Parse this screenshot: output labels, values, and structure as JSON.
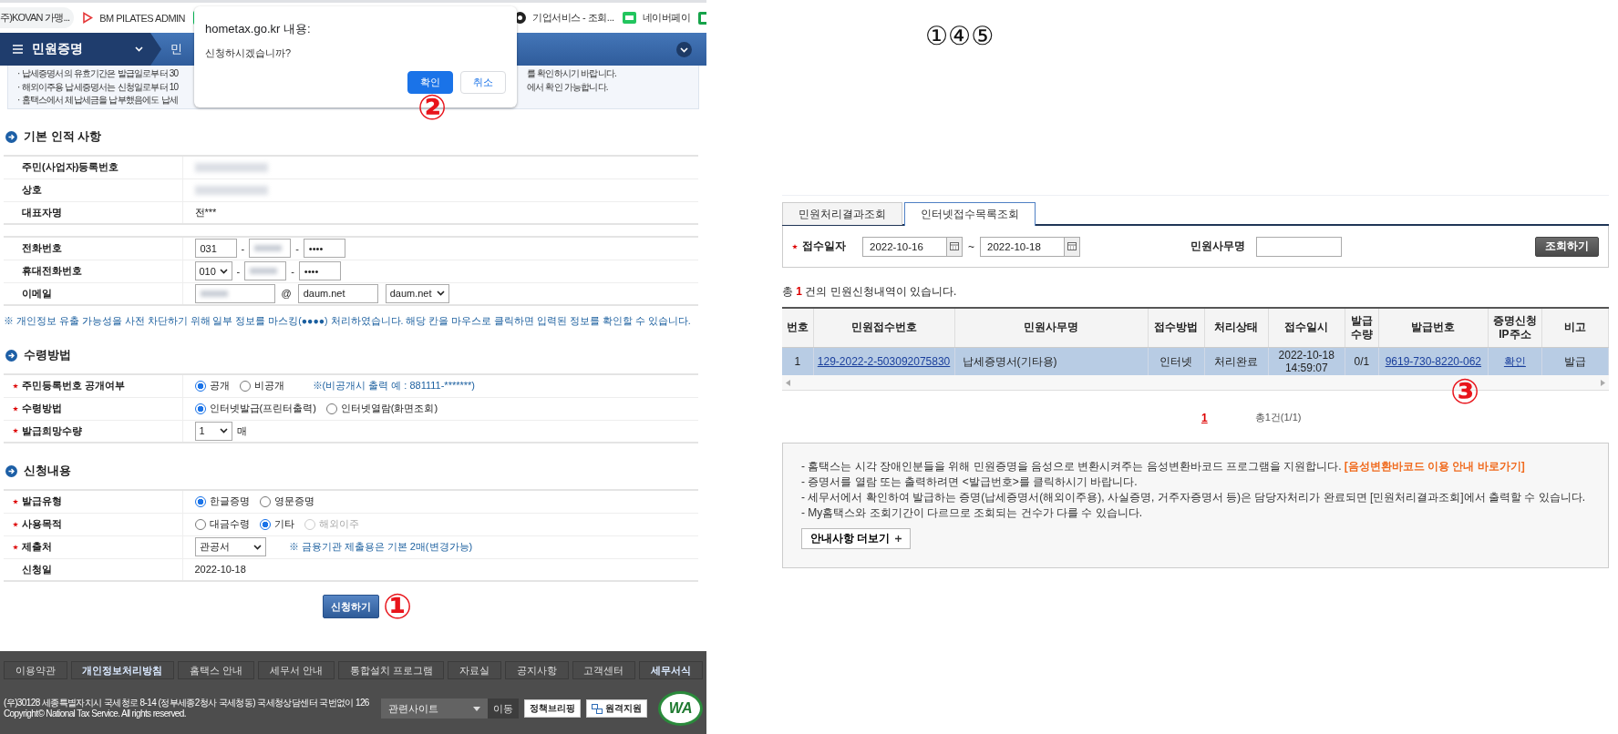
{
  "bookmarks_bar": {
    "items": [
      {
        "kind": "plain",
        "label": "주)KOVAN 가맹..."
      },
      {
        "kind": "triangle",
        "label": "BM PILATES ADMIN"
      },
      {
        "kind": "n-logo"
      },
      {
        "kind": "dark-circle",
        "label": "기업서비스 - 조회..."
      },
      {
        "kind": "pay",
        "label": "네이버페이"
      },
      {
        "kind": "sheet"
      }
    ]
  },
  "nav": {
    "title": "민원증명",
    "breadcrumb": "민"
  },
  "notice": {
    "lines": [
      {
        "left": "· 납세증명서의 유효기간은 발급일로부터 30",
        "right": "를 확인하시기 바랍니다."
      },
      {
        "left": "· 해외이주용 납세증명서는 신청일로부터 10",
        "right": "에서 확인 가능합니다."
      },
      {
        "left": "· 홈택스에서 체납세금을 납부했음에도 납세"
      }
    ]
  },
  "personal_info": {
    "title": "기본 인적 사항",
    "rows": [
      {
        "label": "주민(사업자)등록번호",
        "required": false,
        "kind": "masked"
      },
      {
        "label": "상호",
        "required": false,
        "kind": "masked"
      },
      {
        "label": "대표자명",
        "required": false,
        "kind": "text",
        "value": "전***"
      }
    ],
    "contact_rows": [
      {
        "label": "전화번호",
        "required": false,
        "kind": "fields",
        "fields": [
          {
            "kind": "input",
            "value": "031"
          },
          {
            "kind": "sep",
            "value": "-"
          },
          {
            "kind": "masked"
          },
          {
            "kind": "sep",
            "value": "-"
          },
          {
            "kind": "input",
            "value": "••••"
          }
        ]
      },
      {
        "label": "휴대전화번호",
        "required": false,
        "kind": "fields",
        "fields": [
          {
            "kind": "select",
            "value": "010"
          },
          {
            "kind": "sep",
            "value": "-"
          },
          {
            "kind": "masked"
          },
          {
            "kind": "sep",
            "value": "-"
          },
          {
            "kind": "input",
            "value": "••••"
          }
        ]
      },
      {
        "label": "이메일",
        "required": false,
        "kind": "fields",
        "fields": [
          {
            "kind": "masked"
          },
          {
            "kind": "sep",
            "value": "@"
          },
          {
            "kind": "input",
            "value": "daum.net"
          },
          {
            "kind": "select",
            "value": "daum.net"
          }
        ]
      }
    ],
    "note": "※ 개인정보 유출 가능성을 사전 차단하기 위해 일부 정보를 마스킹(●●●●) 처리하였습니다. 해당 칸을 마우스로 클릭하면 입력된 정보를 확인할 수 있습니다."
  },
  "receipt": {
    "title": "수령방법",
    "rows": [
      {
        "label": "주민등록번호 공개여부",
        "required": true,
        "kind": "radios",
        "options": [
          {
            "label": "공개",
            "selected": true,
            "disabled": false
          },
          {
            "label": "비공개",
            "selected": false,
            "disabled": false
          }
        ],
        "hint": "※(비공개시 출력 예 : 881111-*******)"
      },
      {
        "label": "수령방법",
        "required": true,
        "kind": "radios",
        "options": [
          {
            "label": "인터넷발급(프린터출력)",
            "selected": true,
            "disabled": false
          },
          {
            "label": "인터넷열람(화면조회)",
            "selected": false,
            "disabled": false
          }
        ]
      },
      {
        "label": "발급희망수량",
        "required": true,
        "kind": "select",
        "value": "1",
        "unit": "매"
      }
    ]
  },
  "application": {
    "title": "신청내용",
    "rows": [
      {
        "label": "발급유형",
        "required": true,
        "kind": "radios",
        "options": [
          {
            "label": "한글증명",
            "selected": true,
            "disabled": false
          },
          {
            "label": "영문증명",
            "selected": false,
            "disabled": false
          }
        ]
      },
      {
        "label": "사용목적",
        "required": true,
        "kind": "radios",
        "options": [
          {
            "label": "대금수령",
            "selected": false,
            "disabled": false
          },
          {
            "label": "기타",
            "selected": true,
            "disabled": false
          },
          {
            "label": "해외이주",
            "selected": false,
            "disabled": true
          }
        ]
      },
      {
        "label": "제출처",
        "required": true,
        "kind": "select",
        "value": "관공서",
        "hint": "※ 금융기관 제출용은 기본 2매(변경가능)"
      },
      {
        "label": "신청일",
        "required": false,
        "kind": "text",
        "value": "2022-10-18"
      }
    ]
  },
  "submit_button": "신청하기",
  "footer": {
    "links": [
      {
        "label": "이용약관",
        "emphasized": false
      },
      {
        "label": "개인정보처리방침",
        "emphasized": true
      },
      {
        "label": "홈택스 안내",
        "emphasized": false
      },
      {
        "label": "세무서 안내",
        "emphasized": false
      },
      {
        "label": "통합설치 프로그램",
        "emphasized": false
      },
      {
        "label": "자료실",
        "emphasized": false
      },
      {
        "label": "공지사항",
        "emphasized": false
      },
      {
        "label": "고객센터",
        "emphasized": false
      },
      {
        "label": "세무서식",
        "emphasized": true
      }
    ],
    "address": "(우)30128 세종특별자치시 국세청로 8-14 (정부세종2청사 국세청동) 국세청상담센터 국번없이 126",
    "copyright": "Copyright© National Tax Service. All rights reserved.",
    "related_sites": "관련사이트",
    "go_button": "이동",
    "briefing_button": "정책브리핑",
    "remote_button": "원격지원",
    "badge": "WA"
  },
  "dialog": {
    "title": "hometax.go.kr 내용:",
    "message": "신청하시겠습니까?",
    "buttons": [
      {
        "label": "확인",
        "primary": true
      },
      {
        "label": "취소",
        "primary": false
      }
    ]
  },
  "step_marks": [
    {
      "text": "②"
    },
    {
      "text": "①"
    },
    {
      "text": "③"
    }
  ],
  "top_annotation": "①④⑤",
  "results": {
    "tabs": [
      {
        "label": "민원처리결과조회",
        "selected": false
      },
      {
        "label": "인터넷접수목록조회",
        "selected": true
      }
    ],
    "filter": {
      "date_label": "접수일자",
      "from": "2022-10-16",
      "separator": "~",
      "to": "2022-10-18",
      "name_label": "민원사무명",
      "button": "조회하기"
    },
    "summary": "총 **1** 건의 민원신청내역이 있습니다.",
    "columns": [
      {
        "label": "번호",
        "kind": "text"
      },
      {
        "label": "민원접수번호",
        "kind": "link"
      },
      {
        "label": "민원사무명",
        "kind": "left"
      },
      {
        "label": "접수방법",
        "kind": "text"
      },
      {
        "label": "처리상태",
        "kind": "text"
      },
      {
        "label": "접수일시",
        "kind": "text"
      },
      {
        "label": "발급 수량",
        "kind": "text"
      },
      {
        "label": "발급번호",
        "kind": "link"
      },
      {
        "label": "증명신청 IP주소",
        "kind": "link"
      },
      {
        "label": "비고",
        "kind": "text"
      }
    ],
    "rows": [
      {
        "selected": true,
        "cells": [
          "1",
          "129-2022-2-503092075830",
          "납세증명서(기타용)",
          "인터넷",
          "처리완료",
          "2022-10-18 14:59:07",
          "0/1",
          "9619-730-8220-062",
          "확인",
          "발급"
        ]
      }
    ],
    "pages": [
      {
        "label": "1",
        "selected": true
      }
    ],
    "total": "총1건(1/1)"
  },
  "notes": {
    "lines": [
      {
        "text": "- 홈택스는 시각 장애인분들을 위해 민원증명을 음성으로 변환시켜주는 음성변환바코드 프로그램을 지원합니다.",
        "link": "[음성변환바코드 이용 안내 바로가기]"
      },
      {
        "text": "- 증명서를 열람 또는 출력하려면 <발급번호>를 클릭하시기 바랍니다."
      },
      {
        "text": "- 세무서에서 확인하여 발급하는 증명(납세증명서(해외이주용), 사실증명, 거주자증명서 등)은 담당자처리가 완료되면 [민원처리결과조회]에서 출력할 수 있습니다."
      },
      {
        "text": "- My홈택스와 조회기간이 다르므로 조회되는 건수가 다를 수 있습니다."
      }
    ],
    "more_button": "안내사항 더보기"
  }
}
